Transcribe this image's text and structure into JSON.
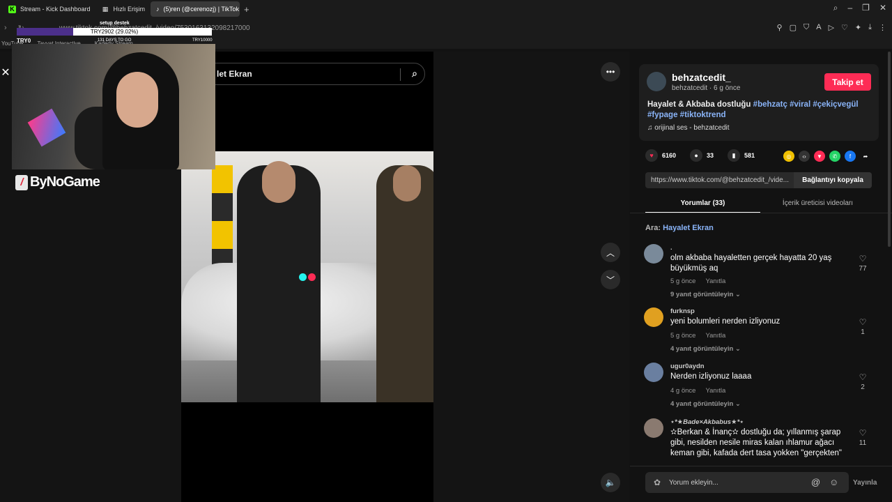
{
  "browser": {
    "tabs": [
      {
        "label": "Stream - Kick Dashboard"
      },
      {
        "label": "Hızlı Erişim"
      },
      {
        "label": "(5)ren (@cerenozj) | TikTok"
      }
    ],
    "url": "www.tiktok.com/@behzatcedit_/video/7530163132098217000",
    "bookmarks": [
      "YouTube",
      "Tayyat Interactive",
      "Kadedy Stream"
    ]
  },
  "overlay": {
    "goal_title": "setup destek",
    "goal_progress_text": "TRY2902 (29.02%)",
    "goal_progress": 0.2902,
    "goal_start": "TRY0",
    "days_to_go": "131 DAYS TO GO",
    "goal_end": "TRY10000",
    "sponsor": "ByNoGame"
  },
  "video": {
    "search_text": "let Ekran"
  },
  "post": {
    "username": "behzatcedit_",
    "subline": "behzatcedit · 6 g önce",
    "follow_label": "Takip et",
    "desc_text": "Hayalet & Akbaba dostluğu",
    "tags": [
      "#behzatç",
      "#viral",
      "#çekiçvegül",
      "#fypage",
      "#tiktoktrend"
    ],
    "sound": "orijinal ses - behzatcedit",
    "likes": "6160",
    "comments_count": "33",
    "saves": "581",
    "link": "https://www.tiktok.com/@behzatcedit_/vide...",
    "copy_label": "Bağlantıyı kopyala",
    "tab_comments": "Yorumlar (33)",
    "tab_creator": "İçerik üreticisi videoları",
    "search_prefix": "Ara:",
    "search_term": "Hayalet Ekran"
  },
  "comments": [
    {
      "author": ".",
      "text": "olm akbaba hayaletten gerçek hayatta 20 yaş büyükmüş aq",
      "time": "5 g önce",
      "reply": "Yanıtla",
      "replies": "9 yanıt görüntüleyin",
      "likes": "77",
      "color": "#7a8a9a"
    },
    {
      "author": "furknsp",
      "text": "yeni bolumleri nerden izliyonuz",
      "time": "5 g önce",
      "reply": "Yanıtla",
      "replies": "4 yanıt görüntüleyin",
      "likes": "1",
      "color": "#e0a020"
    },
    {
      "author": "ugur0aydn",
      "text": "Nerden izliyonuz laaaa",
      "time": "4 g önce",
      "reply": "Yanıtla",
      "replies": "4 yanıt görüntüleyin",
      "likes": "2",
      "color": "#6a7fa0"
    },
    {
      "author": "⋆*★Bade×Akbabus★*⋆",
      "text": "✫Berkan & İnanç✫ dostluğu da; yıllanmış şarap gibi, nesilden nesile miras kalan ıhlamur ağacı keman gibi, kafada dert tasa yokken \"gerçekten\"",
      "time": "",
      "reply": "",
      "replies": "",
      "likes": "11",
      "color": "#8a7a70"
    }
  ],
  "composer": {
    "placeholder": "Yorum ekleyin...",
    "send": "Yayınla"
  }
}
